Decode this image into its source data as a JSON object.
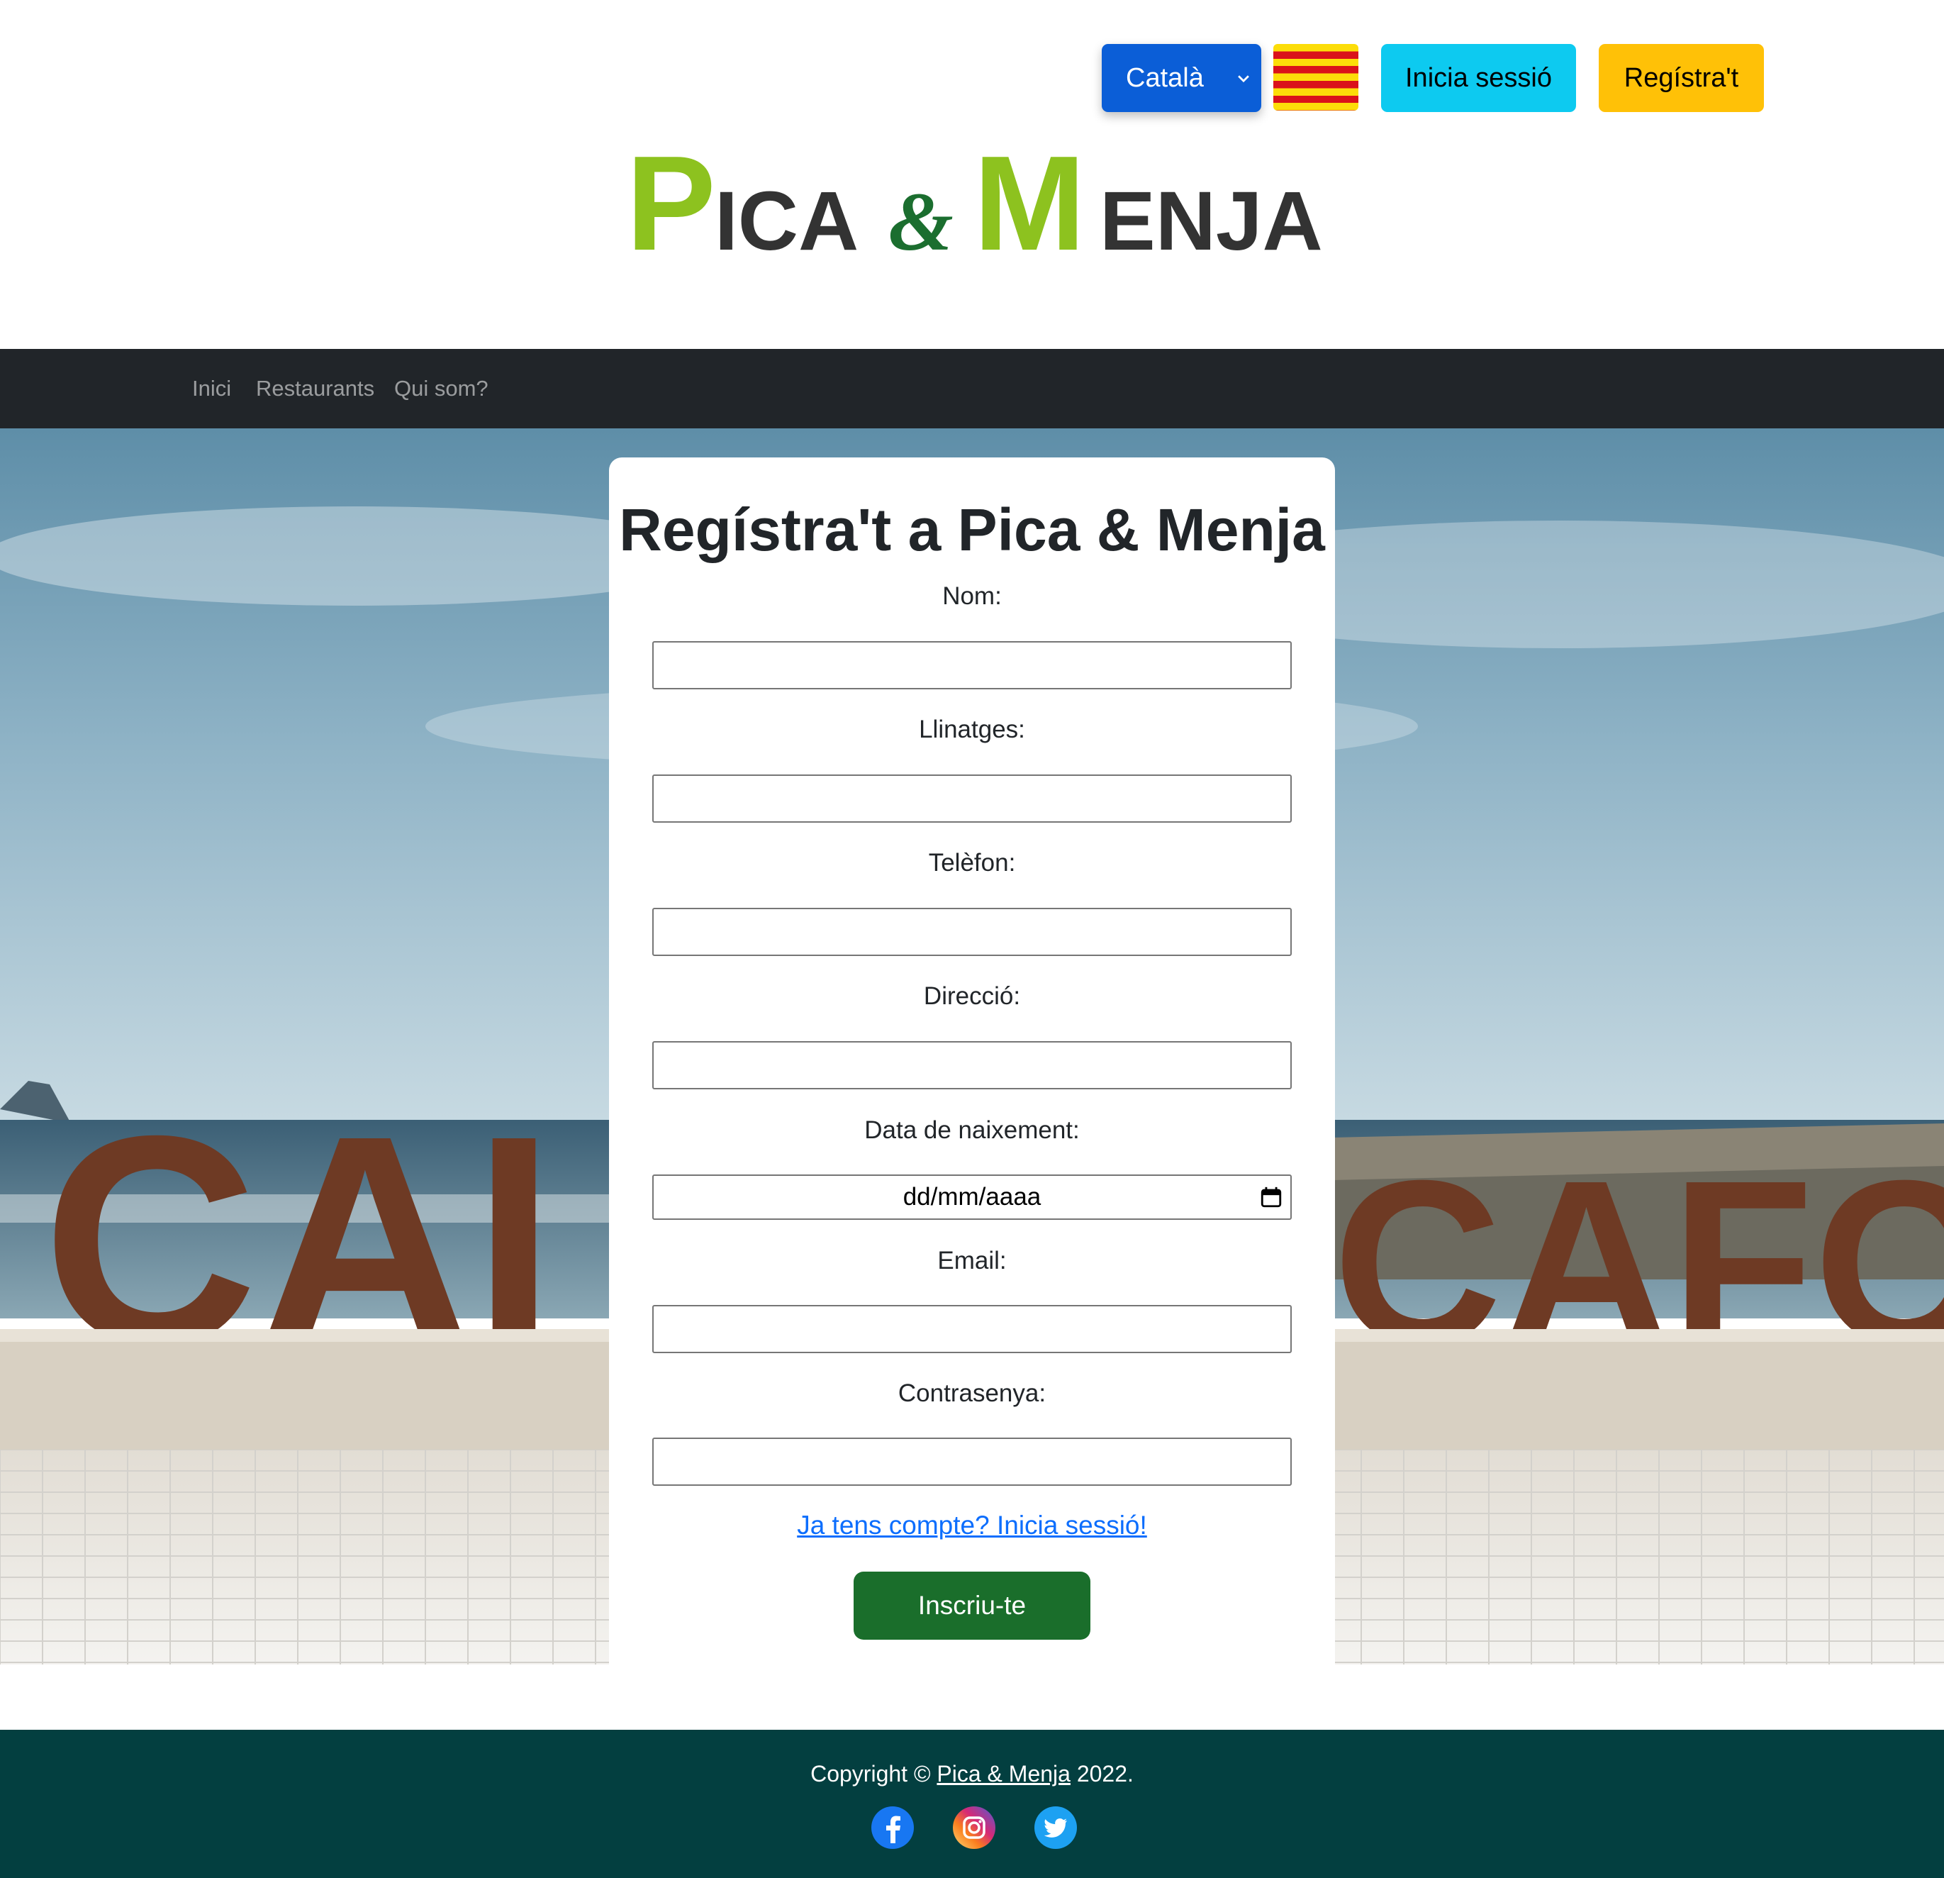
{
  "header": {
    "language_selected": "Català",
    "login_button": "Inicia sessió",
    "register_button": "Regístra't",
    "logo": {
      "first": "Pica",
      "ampersand": "&",
      "second": "Menja",
      "colors": {
        "green": "#8dc21f",
        "dark_green": "#1b6e2f",
        "gray": "#333333"
      }
    }
  },
  "nav": {
    "items": [
      {
        "label": "Inici"
      },
      {
        "label": "Restaurants"
      },
      {
        "label": "Qui som?"
      }
    ]
  },
  "form": {
    "title": "Regístra't a Pica & Menja",
    "fields": [
      {
        "label": "Nom:",
        "value": ""
      },
      {
        "label": "Llinatges:",
        "value": ""
      },
      {
        "label": "Telèfon:",
        "value": ""
      },
      {
        "label": "Direcció:",
        "value": ""
      },
      {
        "label": "Data de naixement:",
        "placeholder": "dd/mm/aaaa"
      },
      {
        "label": "Email:",
        "value": ""
      },
      {
        "label": "Contrasenya:",
        "value": ""
      }
    ],
    "login_link": "Ja tens compte? Inicia sessió!",
    "submit": "Inscriu-te"
  },
  "footer": {
    "copyright_prefix": "Copyright ©",
    "brand_link": "Pica & Menja",
    "year": "2022.",
    "social": [
      "facebook-icon",
      "instagram-icon",
      "twitter-icon"
    ]
  },
  "colors": {
    "select_blue": "#0b5ed7",
    "login_cyan": "#0dcaf0",
    "register_yellow": "#ffc107",
    "navbar": "#212529",
    "submit_green": "#1a6e2b",
    "footer": "#033f40",
    "link_blue": "#0d6efd"
  }
}
